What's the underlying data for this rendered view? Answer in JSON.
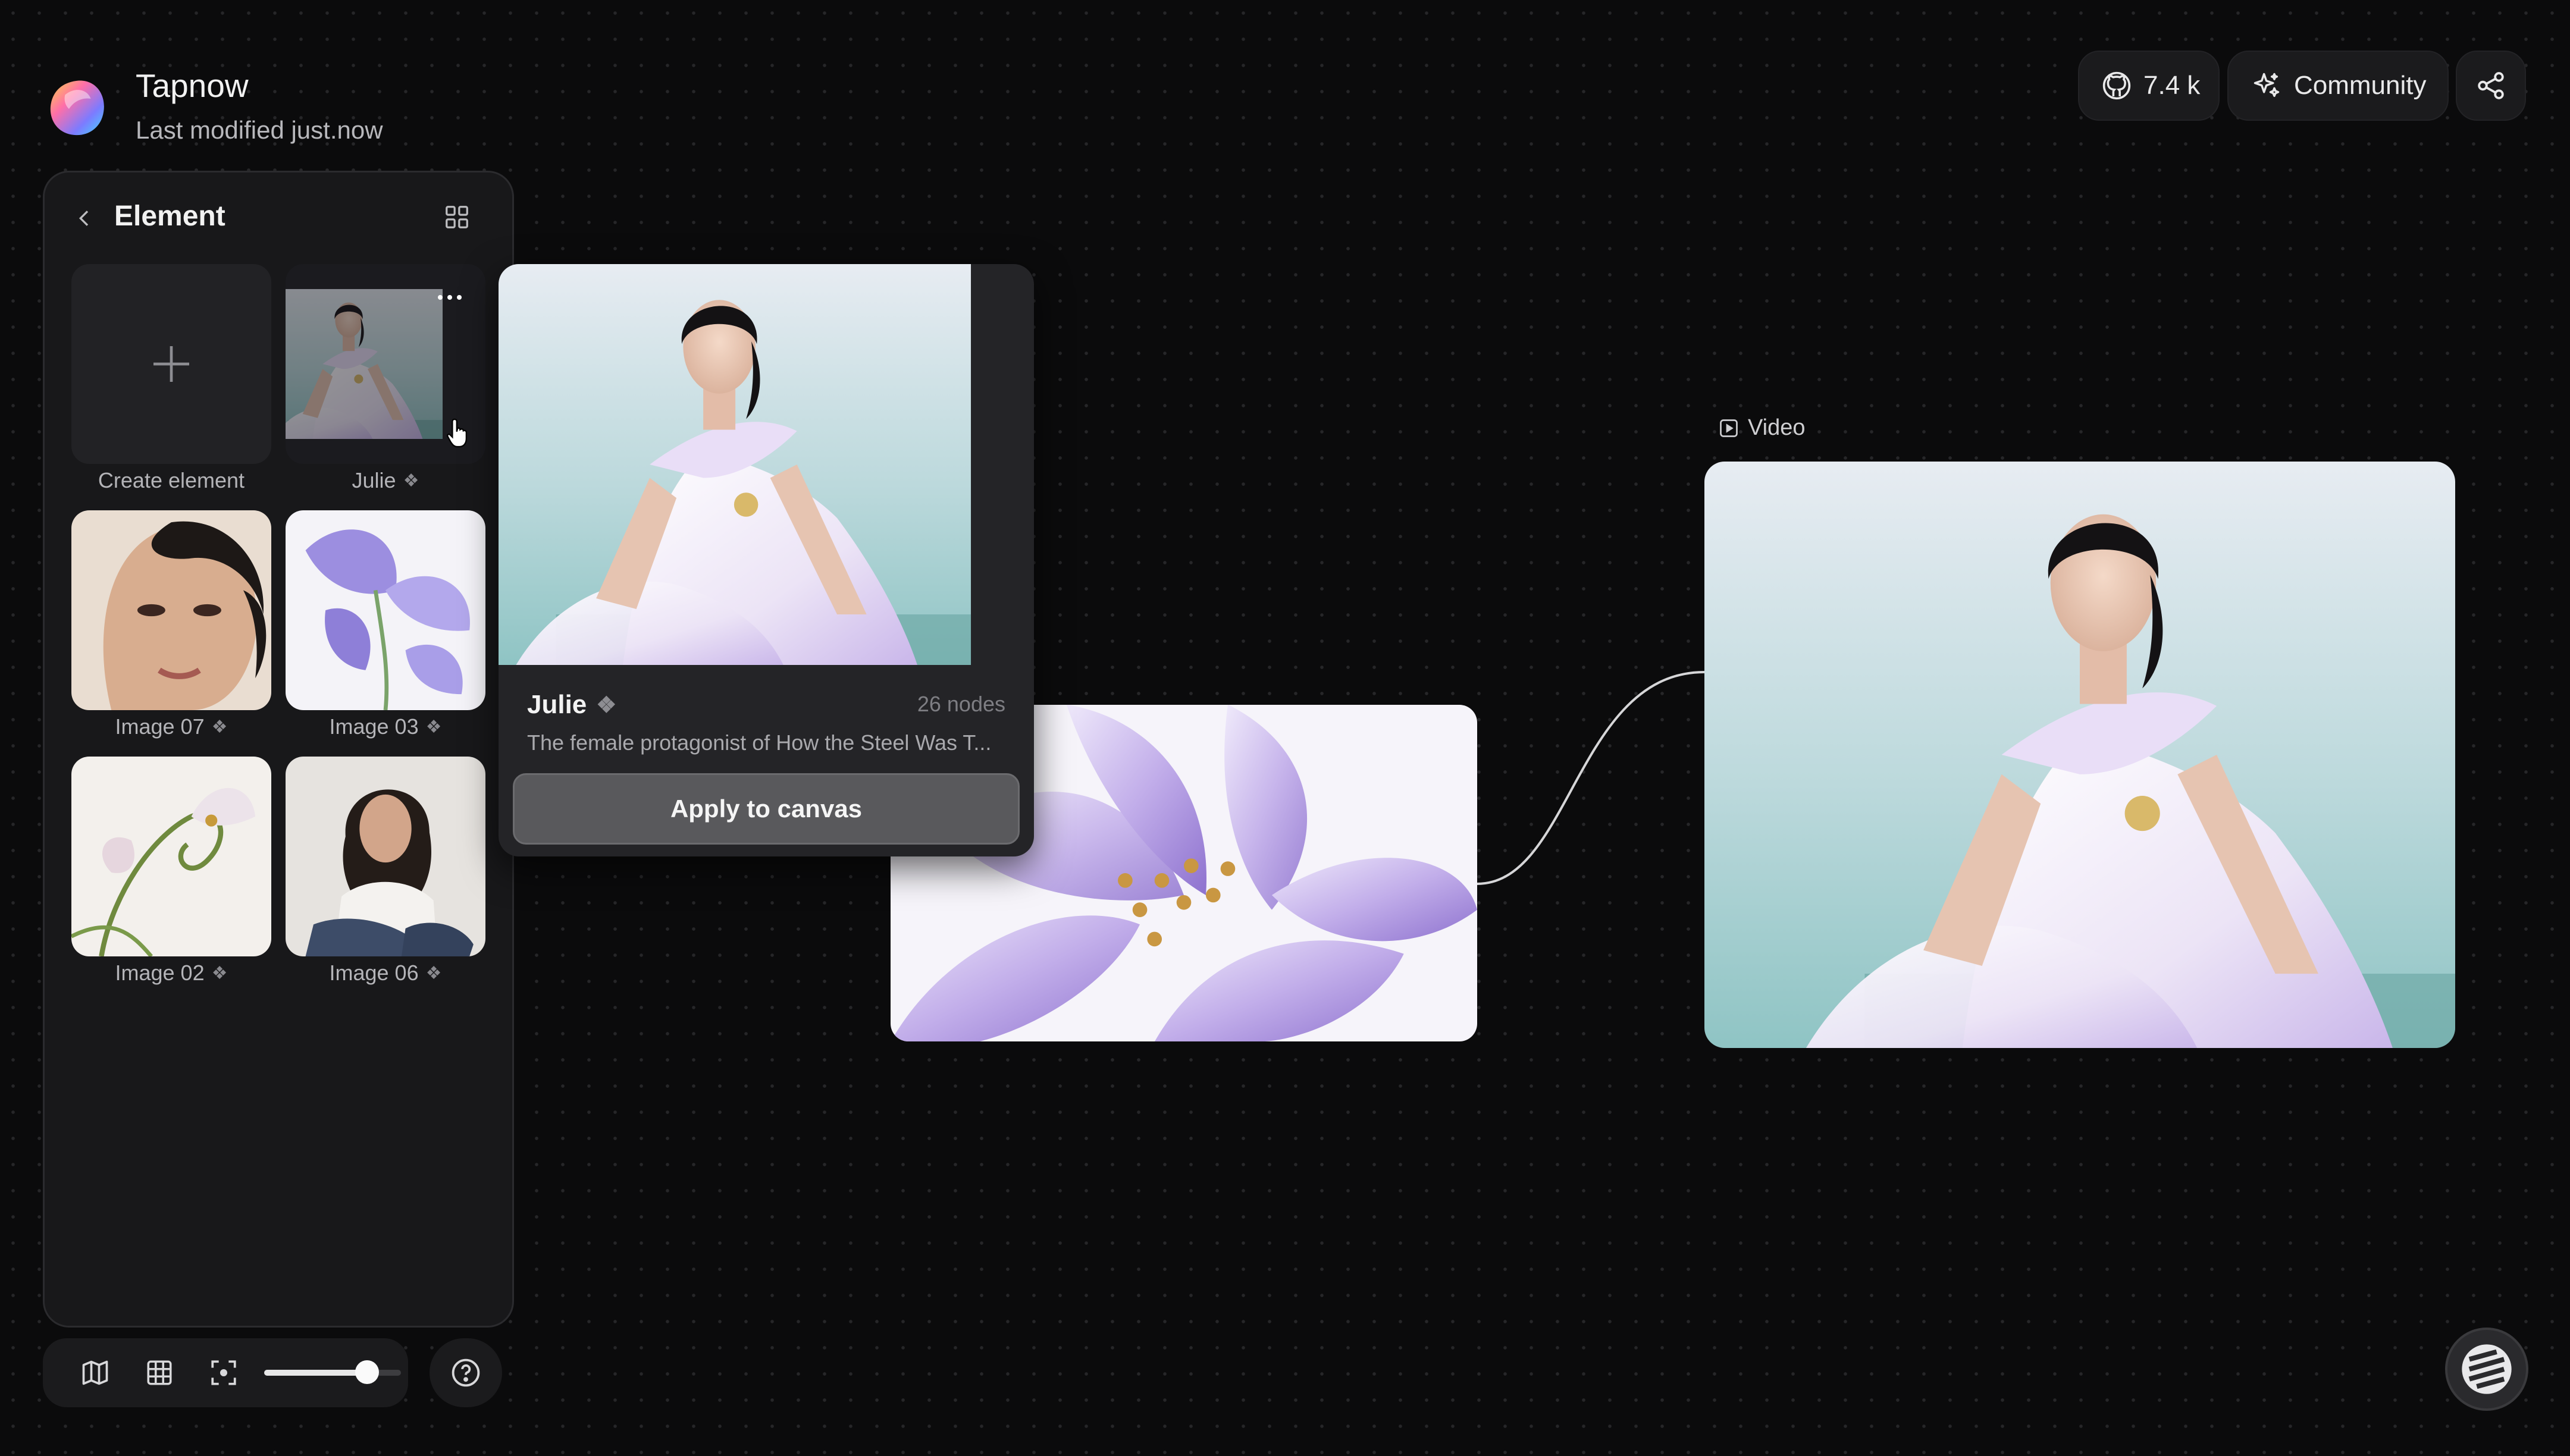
{
  "header": {
    "app_name": "Tapnow",
    "subtitle": "Last modified just.now",
    "stars": "7.4 k",
    "community_label": "Community",
    "icons": [
      "app-logo-icon",
      "github-icon",
      "sparkle-icon",
      "share-icon"
    ]
  },
  "sidebar": {
    "title": "Element",
    "icons": [
      "chevron-left-icon",
      "grid-view-icon",
      "more-dots-icon",
      "plus-icon",
      "component-icon"
    ],
    "tiles": [
      {
        "label": "Create element",
        "has_badge": false
      },
      {
        "label": "Julie",
        "has_badge": true
      },
      {
        "label": "Image 07",
        "has_badge": true
      },
      {
        "label": "Image 03",
        "has_badge": true
      },
      {
        "label": "Image 02",
        "has_badge": true
      },
      {
        "label": "Image 06",
        "has_badge": true
      }
    ]
  },
  "popover": {
    "name": "Julie",
    "nodes": "26 nodes",
    "description": "The female protagonist of How the Steel Was T...",
    "apply_label": "Apply to canvas"
  },
  "canvas": {
    "video_label": "Video"
  },
  "toolbar": {
    "icons": [
      "map-icon",
      "grid-icon",
      "fit-screen-icon",
      "help-icon"
    ],
    "zoom_level": 0.75
  },
  "colors": {
    "background": "#0b0b0c",
    "panel": "#18181a",
    "button": "#59595c",
    "lavender": "#b9a6e6",
    "teal": "#a9d2d0"
  }
}
